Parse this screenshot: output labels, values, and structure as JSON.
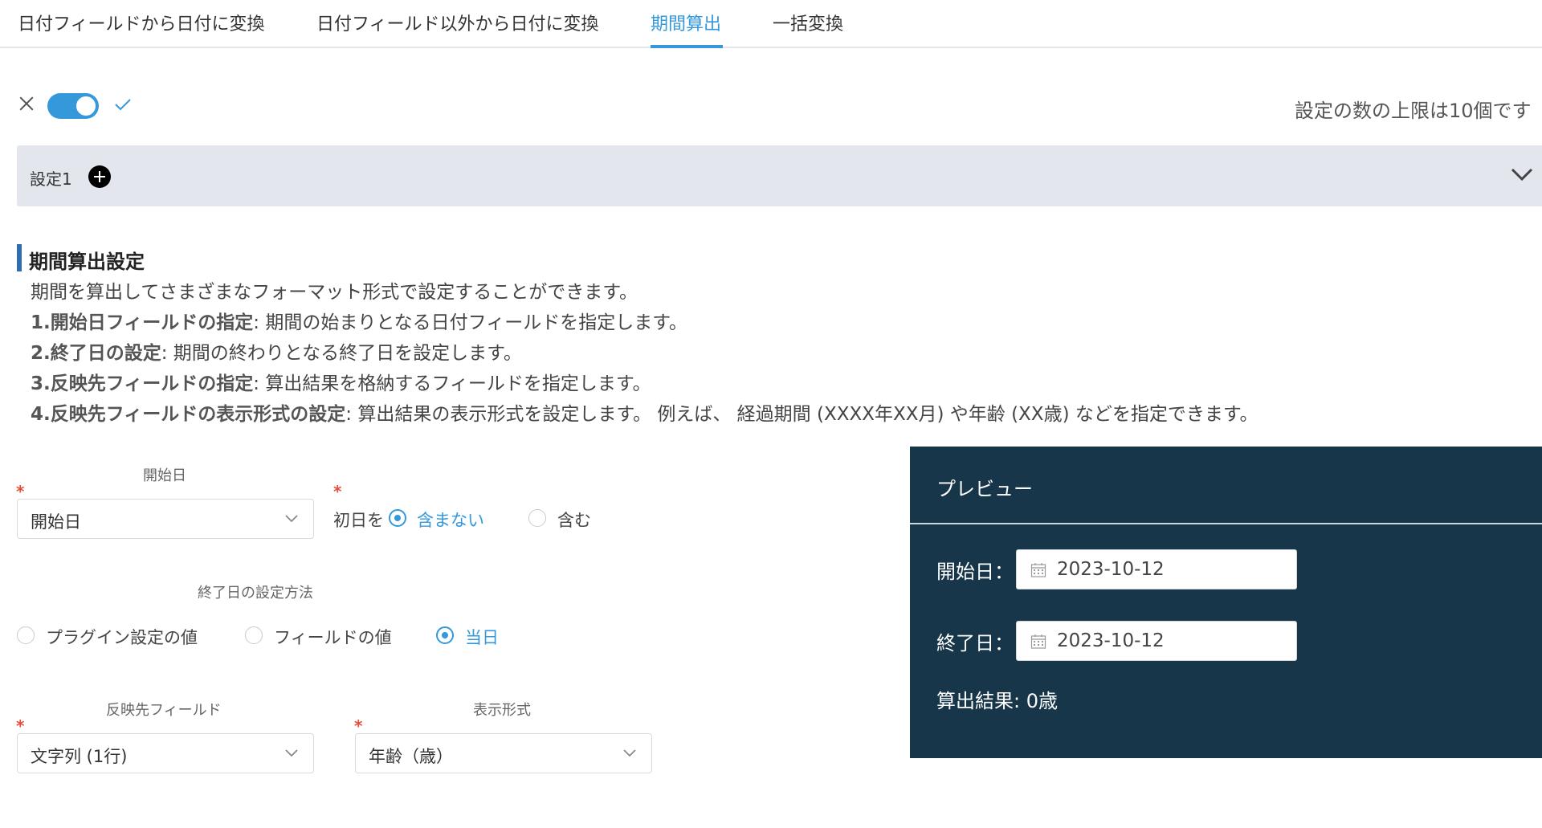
{
  "tabs": [
    {
      "label": "日付フィールドから日付に変換",
      "active": false
    },
    {
      "label": "日付フィールド以外から日付に変換",
      "active": false
    },
    {
      "label": "期間算出",
      "active": true
    },
    {
      "label": "一括変換",
      "active": false
    }
  ],
  "toolbar": {
    "toggle_on": true,
    "limit_note": "設定の数の上限は10個です"
  },
  "settings": {
    "label": "設定1"
  },
  "section": {
    "title": "期間算出設定",
    "intro": "期間を算出してさまざまなフォーマット形式で設定することができます。",
    "steps": [
      {
        "bold": "1.開始日フィールドの指定",
        "text": ": 期間の始まりとなる日付フィールドを指定します。"
      },
      {
        "bold": "2.終了日の設定",
        "text": ": 期間の終わりとなる終了日を設定します。"
      },
      {
        "bold": "3.反映先フィールドの指定",
        "text": ": 算出結果を格納するフィールドを指定します。"
      },
      {
        "bold": "4.反映先フィールドの表示形式の設定",
        "text": ": 算出結果の表示形式を設定します。 例えば、 経過期間 (XXXX年XX月) や年齢 (XX歳) などを指定できます。"
      }
    ]
  },
  "form": {
    "required_mark": "*",
    "start": {
      "label": "開始日",
      "value": "開始日",
      "first_day_prefix": "初日を",
      "options": [
        {
          "label": "含まない",
          "selected": true
        },
        {
          "label": "含む",
          "selected": false
        }
      ]
    },
    "end": {
      "label": "終了日の設定方法",
      "options": [
        {
          "label": "プラグイン設定の値",
          "selected": false
        },
        {
          "label": "フィールドの値",
          "selected": false
        },
        {
          "label": "当日",
          "selected": true
        }
      ]
    },
    "target": {
      "label": "反映先フィールド",
      "value": "文字列 (1行)"
    },
    "format": {
      "label": "表示形式",
      "value": "年齢（歳）"
    }
  },
  "preview": {
    "title": "プレビュー",
    "start_label": "開始日：",
    "start_value": "2023-10-12",
    "end_label": "終了日：",
    "end_value": "2023-10-12",
    "result": "算出結果: 0歳"
  },
  "colors": {
    "accent": "#3498db",
    "preview_bg": "#17364a",
    "settings_bar": "#e3e7ed",
    "required": "#e74c3c"
  }
}
